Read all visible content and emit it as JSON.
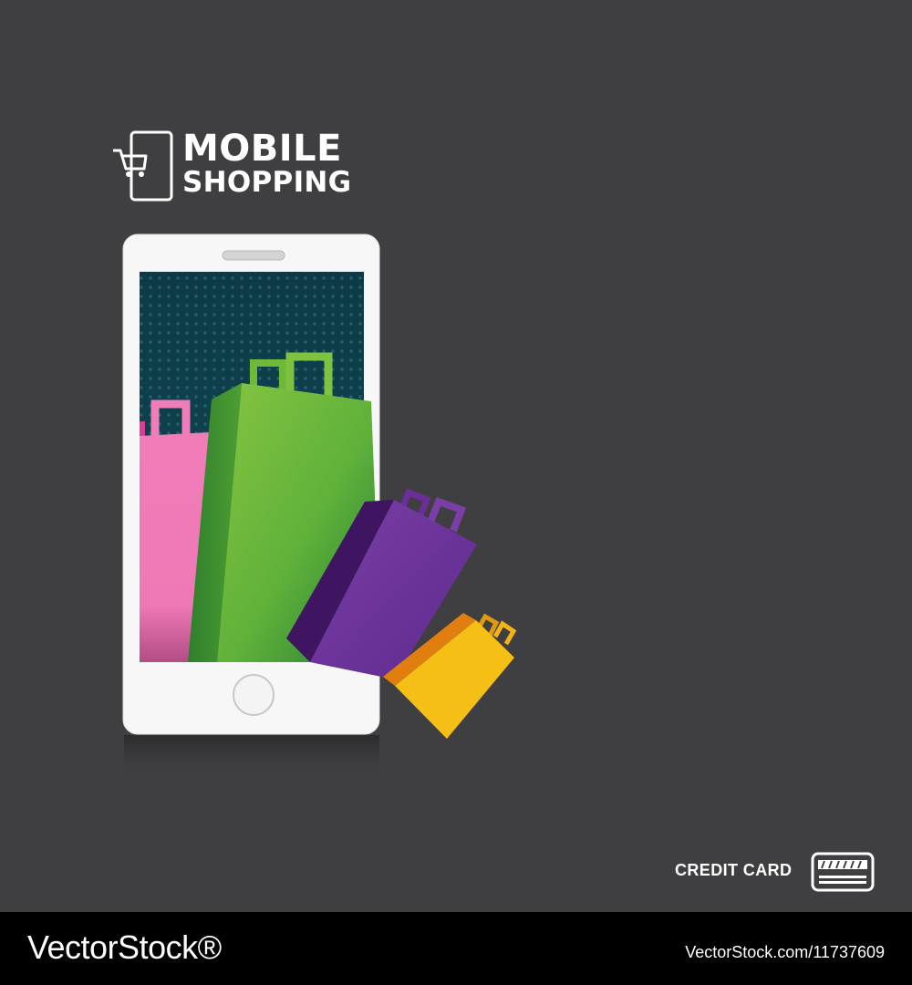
{
  "logo": {
    "line1": "MOBILE",
    "line2": "SHOPPING",
    "icon": "phone-cart-icon"
  },
  "credit_card": {
    "label": "CREDIT CARD",
    "icon": "credit-card-icon"
  },
  "watermark": {
    "brand": "VectorStock®",
    "reference": "VectorStock.com/11737609"
  },
  "colors": {
    "background": "#3f3f41",
    "phone_body": "#f7f7f7",
    "screen": "#0f3d49",
    "bag_pink": "#ef77b5",
    "bag_green": "#6fb93a",
    "bag_purple": "#6b2d97",
    "bag_yellow": "#f5bf16",
    "footer": "#000000"
  }
}
